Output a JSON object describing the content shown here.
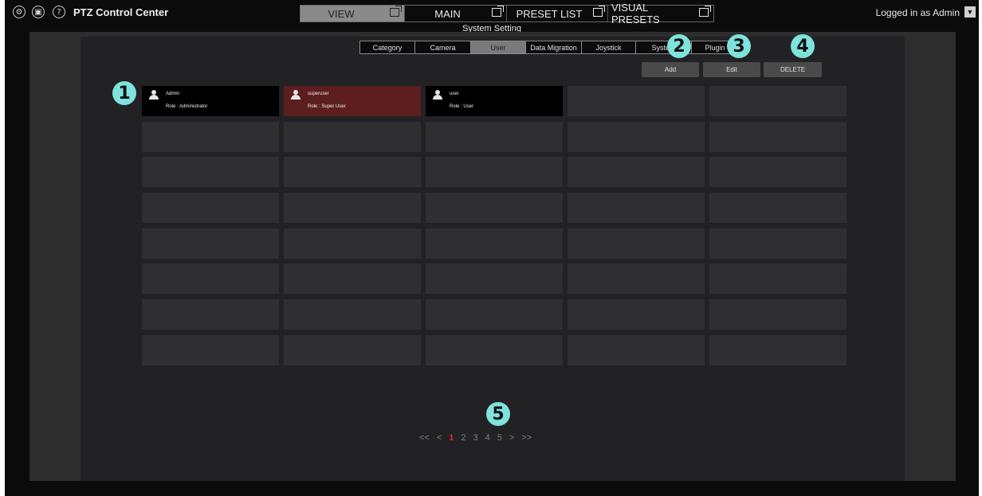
{
  "topbar": {
    "icons": [
      "gear-icon",
      "camera-icon",
      "help-icon"
    ],
    "help_glyph": "?",
    "app_title": "PTZ Control Center",
    "tabs": [
      {
        "label": "VIEW",
        "active": true
      },
      {
        "label": "MAIN",
        "active": false
      },
      {
        "label": "PRESET LIST",
        "active": false
      },
      {
        "label": "VISUAL PRESETS",
        "active": false
      }
    ],
    "login": "Logged in as Admin",
    "login_caret": "▼"
  },
  "settings": {
    "title": "System Setting",
    "tabs": [
      {
        "label": "Category",
        "active": false
      },
      {
        "label": "Camera",
        "active": false
      },
      {
        "label": "User",
        "active": true
      },
      {
        "label": "Data Migration",
        "active": false
      },
      {
        "label": "Joystick",
        "active": false
      },
      {
        "label": "System",
        "active": false
      },
      {
        "label": "Plugin",
        "active": false
      }
    ],
    "buttons": {
      "add": "Add",
      "edit": "Edit",
      "delete": "DELETE"
    }
  },
  "users": [
    {
      "name": "Admin",
      "role": "Role : Administrator",
      "selected": false
    },
    {
      "name": "superuser",
      "role": "Role : Super User",
      "selected": true
    },
    {
      "name": "user",
      "role": "Role : User",
      "selected": false
    }
  ],
  "pagination": {
    "first": "<<",
    "prev": "<",
    "pages": [
      "1",
      "2",
      "3",
      "4",
      "5"
    ],
    "current": "1",
    "next": ">",
    "last": ">>"
  },
  "callouts": [
    "1",
    "2",
    "3",
    "4",
    "5"
  ],
  "colors": {
    "selected_user": "#5c1e1e",
    "current_page": "#e02b2b",
    "callout": "#7fe3dc"
  }
}
